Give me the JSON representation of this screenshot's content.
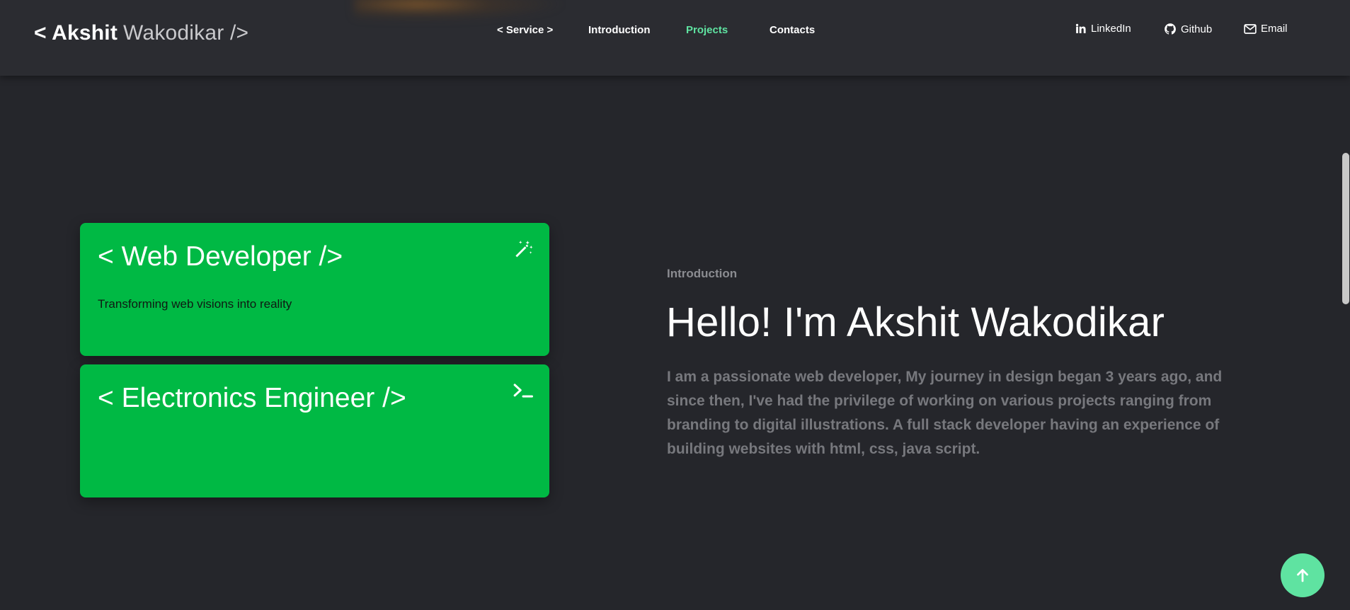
{
  "header": {
    "logo_first": "< Akshit",
    "logo_last": "Wakodikar />",
    "nav": [
      {
        "label": "< Service >",
        "active": false
      },
      {
        "label": "Introduction",
        "active": false
      },
      {
        "label": "Projects",
        "active": true
      },
      {
        "label": "Contacts",
        "active": false
      }
    ],
    "social": [
      {
        "label": "LinkedIn",
        "icon": "linkedin-icon"
      },
      {
        "label": "Github",
        "icon": "github-icon"
      },
      {
        "label": "Email",
        "icon": "email-icon"
      }
    ]
  },
  "cards": [
    {
      "title": "< Web Developer />",
      "description": "Transforming web visions into reality",
      "icon": "magic-wand-icon"
    },
    {
      "title": "< Electronics Engineer />",
      "description": "",
      "icon": "terminal-icon"
    }
  ],
  "intro": {
    "eyebrow": "Introduction",
    "title": "Hello! I'm Akshit Wakodikar",
    "text": "I am a passionate web developer, My journey in design began 3 years ago, and since then, I've had the privilege of working on various projects ranging from branding to digital illustrations. A full stack developer having an experience of building websites with html, css, java script."
  },
  "back_to_top": {
    "icon": "arrow-up-icon"
  },
  "colors": {
    "background": "#25262b",
    "header": "#2b2c31",
    "accent_green": "#00b944",
    "active_nav": "#5fe3a1",
    "muted_text": "#77787d"
  }
}
